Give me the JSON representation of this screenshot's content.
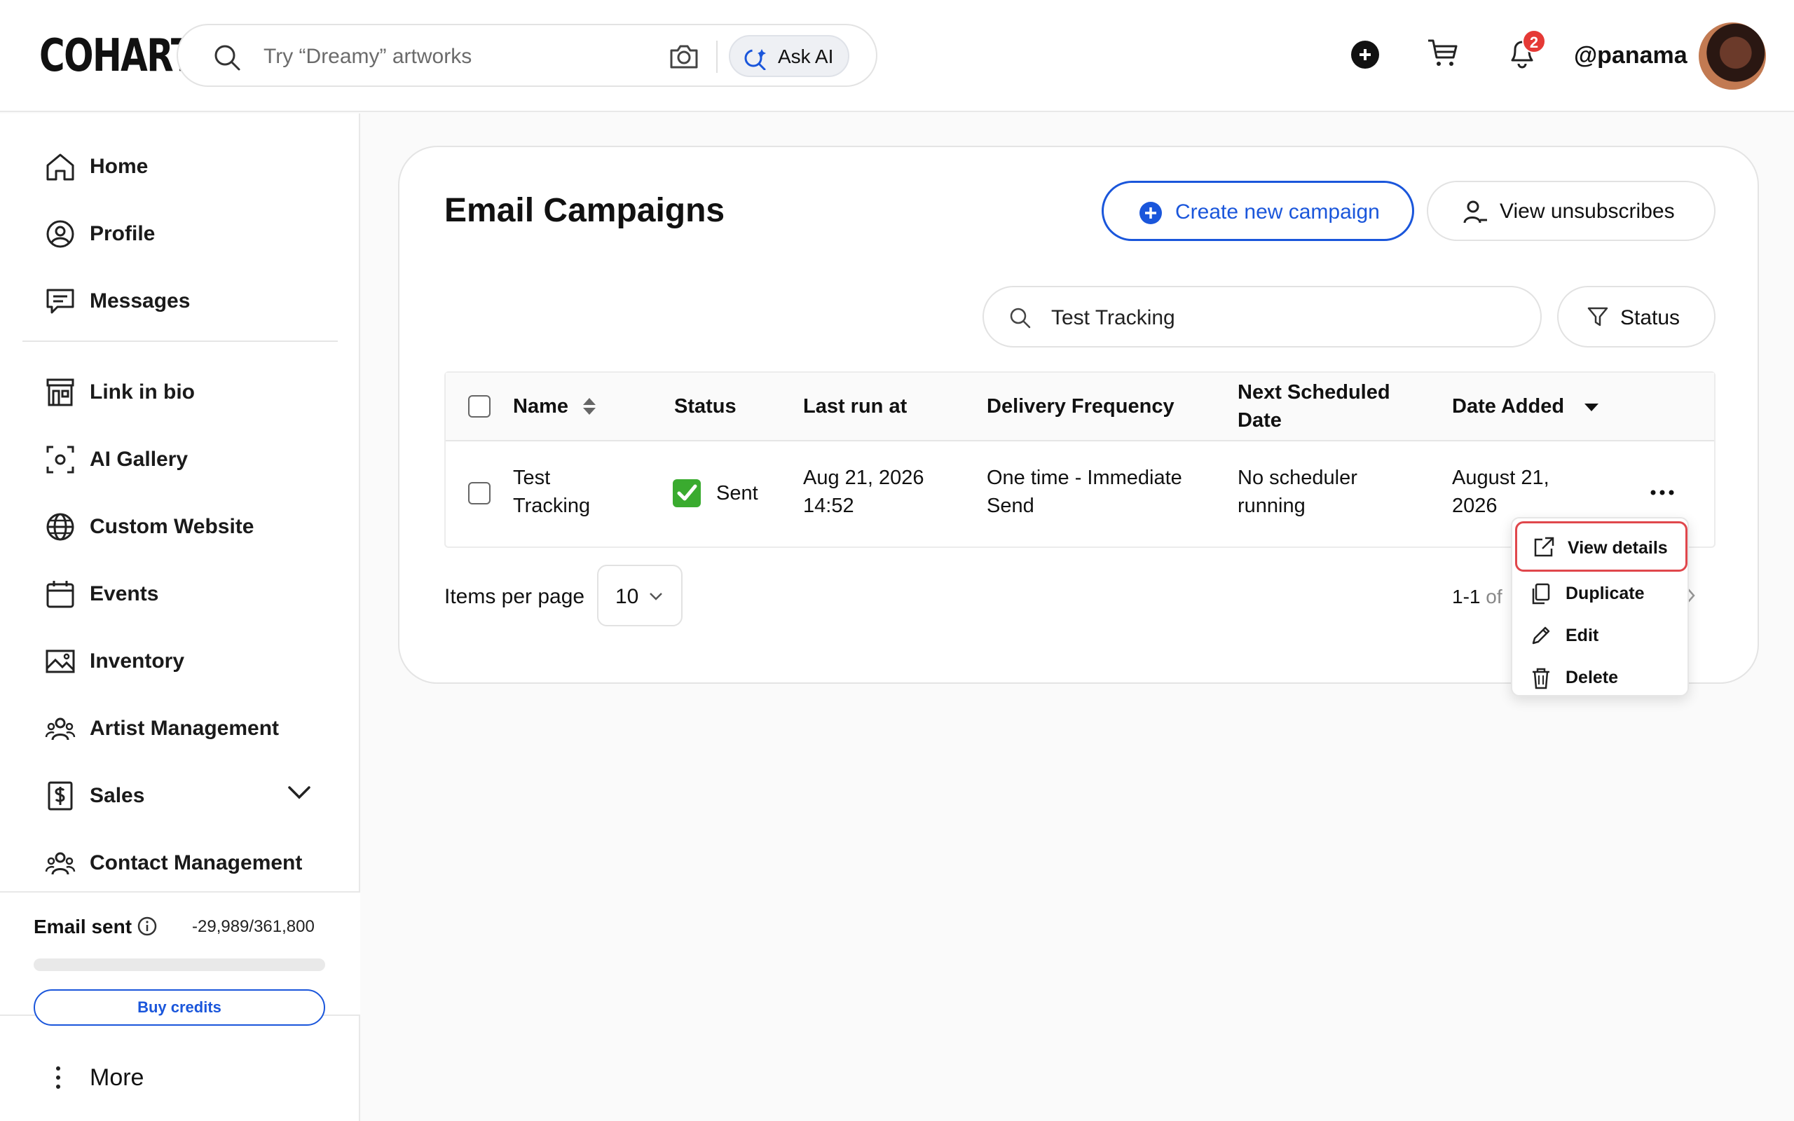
{
  "header": {
    "logo": "COHART",
    "search_placeholder": "Try “Dreamy” artworks",
    "ask_ai_label": "Ask AI",
    "notification_count": "2",
    "username": "@panama"
  },
  "sidebar": {
    "items": [
      {
        "label": "Home",
        "icon": "home-icon"
      },
      {
        "label": "Profile",
        "icon": "profile-icon"
      },
      {
        "label": "Messages",
        "icon": "messages-icon"
      },
      {
        "label": "Link in bio",
        "icon": "storefront-icon"
      },
      {
        "label": "AI Gallery",
        "icon": "ai-gallery-icon"
      },
      {
        "label": "Custom Website",
        "icon": "globe-icon"
      },
      {
        "label": "Events",
        "icon": "calendar-icon"
      },
      {
        "label": "Inventory",
        "icon": "image-icon"
      },
      {
        "label": "Artist Management",
        "icon": "people-icon"
      },
      {
        "label": "Sales",
        "icon": "dollar-icon"
      },
      {
        "label": "Contact Management",
        "icon": "people-icon"
      }
    ],
    "email_sent_label": "Email sent",
    "email_sent_count": "-29,989/361,800",
    "email_sent_progress": 0,
    "buy_credits_label": "Buy credits",
    "more_label": "More"
  },
  "main": {
    "title": "Email Campaigns",
    "create_button": "Create new campaign",
    "unsubscribes_button": "View unsubscribes",
    "search_value": "Test Tracking",
    "status_filter": "Status",
    "table": {
      "columns": [
        "Name",
        "Status",
        "Last run at",
        "Delivery Frequency",
        "Next Scheduled Date",
        "Date Added"
      ],
      "rows": [
        {
          "name": "Test Tracking",
          "status": "Sent",
          "last_run": "Aug 21, 2026 14:52",
          "frequency": "One time - Immediate Send",
          "next_scheduled": "No scheduler running",
          "date_added": "August 21, 2026"
        }
      ]
    },
    "items_per_page_label": "Items per page",
    "items_per_page_value": "10",
    "range_prefix": "1-1",
    "range_of": "of"
  },
  "row_menu": {
    "items": [
      "View details",
      "Duplicate",
      "Edit",
      "Delete"
    ]
  },
  "colors": {
    "accent": "#1a56db",
    "badge": "#e53935",
    "sent": "#3aab2f",
    "highlight": "#e0474c"
  }
}
